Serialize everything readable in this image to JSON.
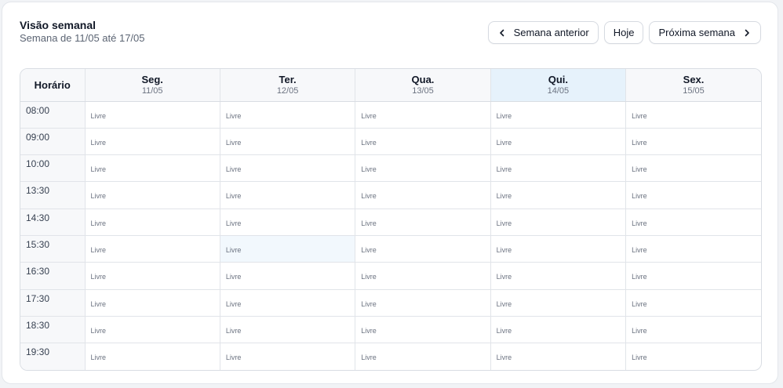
{
  "header": {
    "title": "Visão semanal",
    "subtitle": "Semana de 11/05 até 17/05"
  },
  "nav": {
    "prev_label": "Semana anterior",
    "today_label": "Hoje",
    "next_label": "Próxima semana",
    "prev_icon": "chevron-left-icon",
    "next_icon": "chevron-right-icon"
  },
  "table": {
    "time_header": "Horário",
    "days": [
      {
        "name": "Seg.",
        "date": "11/05"
      },
      {
        "name": "Ter.",
        "date": "12/05"
      },
      {
        "name": "Qua.",
        "date": "13/05"
      },
      {
        "name": "Qui.",
        "date": "14/05"
      },
      {
        "name": "Sex.",
        "date": "15/05"
      }
    ],
    "highlighted_day": "Qui.",
    "highlight_color": "#e6f2fb",
    "hovered_cell": {
      "time": "15:30",
      "day": "Ter."
    },
    "slot_label": "Livre",
    "times": [
      "08:00",
      "09:00",
      "10:00",
      "13:30",
      "14:30",
      "15:30",
      "16:30",
      "17:30",
      "18:30",
      "19:30"
    ]
  }
}
